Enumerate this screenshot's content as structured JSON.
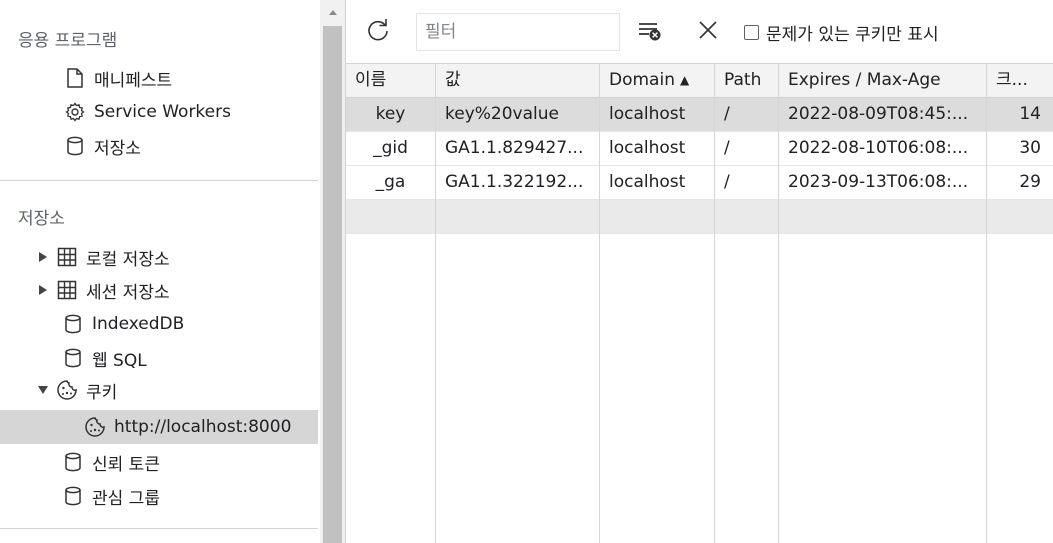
{
  "sidebar": {
    "app_section_title": "응용 프로그램",
    "app_items": [
      {
        "label": "매니페스트",
        "icon": "document-icon"
      },
      {
        "label": "Service Workers",
        "icon": "gear-icon"
      },
      {
        "label": "저장소",
        "icon": "database-icon"
      }
    ],
    "storage_section_title": "저장소",
    "storage_items": [
      {
        "label": "로컬 저장소",
        "icon": "table-grid-icon",
        "expander": "collapsed"
      },
      {
        "label": "세션 저장소",
        "icon": "table-grid-icon",
        "expander": "collapsed"
      },
      {
        "label": "IndexedDB",
        "icon": "database-icon"
      },
      {
        "label": "웹 SQL",
        "icon": "database-icon"
      },
      {
        "label": "쿠키",
        "icon": "cookie-icon",
        "expander": "expanded"
      },
      {
        "label": "http://localhost:8000",
        "icon": "cookie-icon",
        "selected": true
      },
      {
        "label": "신뢰 토큰",
        "icon": "database-icon"
      },
      {
        "label": "관심 그룹",
        "icon": "database-icon"
      }
    ]
  },
  "toolbar": {
    "refresh_icon": "refresh-icon",
    "filter_placeholder": "필터",
    "clear_filtered_icon": "clear-filtered-icon",
    "delete_all_icon": "close-icon",
    "checkbox_label": "문제가 있는 쿠키만 표시",
    "checkbox_checked": false
  },
  "table": {
    "columns": [
      {
        "label": "이름"
      },
      {
        "label": "값"
      },
      {
        "label": "Domain",
        "sort": "ascending"
      },
      {
        "label": "Path"
      },
      {
        "label": "Expires / Max-Age"
      },
      {
        "label": "크..."
      }
    ],
    "rows": [
      {
        "name": "key",
        "value": "key%20value",
        "domain": "localhost",
        "path": "/",
        "expires": "2022-08-09T08:45:...",
        "size": "14",
        "selected": true
      },
      {
        "name": "_gid",
        "value": "GA1.1.829427...",
        "domain": "localhost",
        "path": "/",
        "expires": "2022-08-10T06:08:...",
        "size": "30"
      },
      {
        "name": "_ga",
        "value": "GA1.1.322192...",
        "domain": "localhost",
        "path": "/",
        "expires": "2023-09-13T06:08:...",
        "size": "29"
      }
    ]
  },
  "colors": {
    "selected_row": "#dcdcdc",
    "sidebar_selected": "#d6d6d6",
    "header_bg": "#f3f3f3",
    "scrollbar_thumb": "#c1c1c1"
  }
}
